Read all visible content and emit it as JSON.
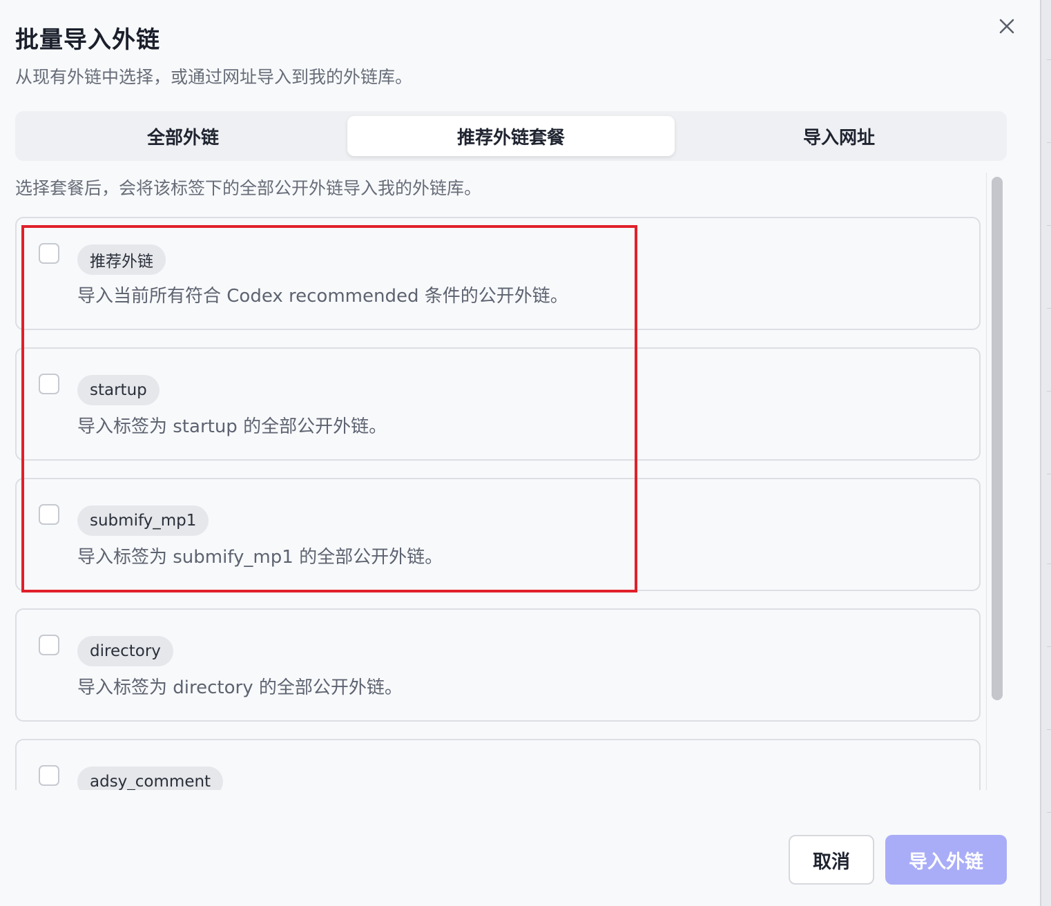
{
  "dialog": {
    "title": "批量导入外链",
    "subtitle": "从现有外链中选择，或通过网址导入到我的外链库。"
  },
  "tabs": [
    {
      "label": "全部外链",
      "active": false
    },
    {
      "label": "推荐外链套餐",
      "active": true
    },
    {
      "label": "导入网址",
      "active": false
    }
  ],
  "hint": "选择套餐后，会将该标签下的全部公开外链导入我的外链库。",
  "packages": [
    {
      "tag": "推荐外链",
      "description": "导入当前所有符合 Codex recommended 条件的公开外链。",
      "checked": false
    },
    {
      "tag": "startup",
      "description": "导入标签为 startup 的全部公开外链。",
      "checked": false
    },
    {
      "tag": "submify_mp1",
      "description": "导入标签为 submify_mp1 的全部公开外链。",
      "checked": false
    },
    {
      "tag": "directory",
      "description": "导入标签为 directory 的全部公开外链。",
      "checked": false
    },
    {
      "tag": "adsy_comment",
      "description": "",
      "checked": false
    }
  ],
  "footer": {
    "cancel_label": "取消",
    "import_label": "导入外链"
  },
  "colors": {
    "primary_disabled": "#a9adf7",
    "highlight": "#e0202a",
    "active_tab_bg": "#ffffff"
  },
  "icons": {
    "close": "close-icon"
  }
}
